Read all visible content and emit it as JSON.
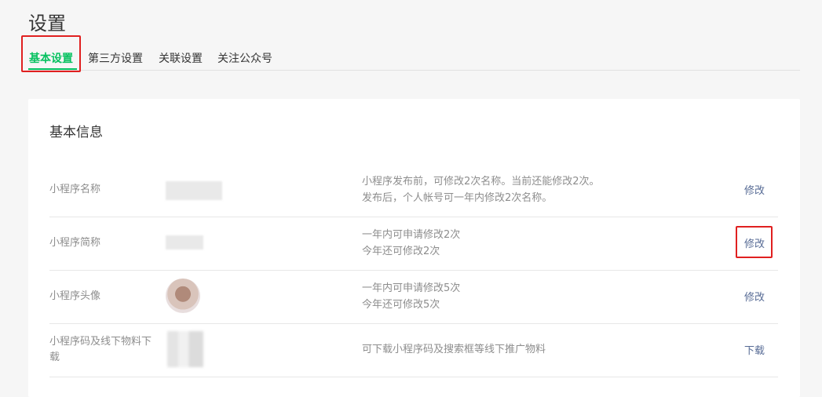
{
  "page": {
    "title": "设置"
  },
  "tabs": [
    {
      "label": "基本设置",
      "active": true
    },
    {
      "label": "第三方设置",
      "active": false
    },
    {
      "label": "关联设置",
      "active": false
    },
    {
      "label": "关注公众号",
      "active": false
    }
  ],
  "section": {
    "title": "基本信息"
  },
  "rows": [
    {
      "label": "小程序名称",
      "desc": [
        "小程序发布前，可修改2次名称。当前还能修改2次。",
        "发布后，个人帐号可一年内修改2次名称。"
      ],
      "action": "修改"
    },
    {
      "label": "小程序简称",
      "desc": [
        "一年内可申请修改2次",
        "今年还可修改2次"
      ],
      "action": "修改"
    },
    {
      "label": "小程序头像",
      "desc": [
        "一年内可申请修改5次",
        "今年还可修改5次"
      ],
      "action": "修改"
    },
    {
      "label": "小程序码及线下物料下载",
      "desc": [
        "可下载小程序码及搜索框等线下推广物料"
      ],
      "action": "下载"
    }
  ],
  "colors": {
    "accent": "#07c160",
    "link": "#576b95",
    "highlight": "#e02020"
  }
}
